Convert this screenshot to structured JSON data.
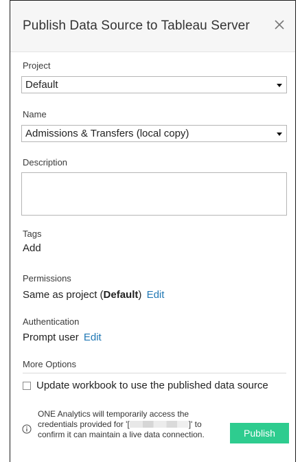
{
  "dialog": {
    "title": "Publish Data Source to Tableau Server",
    "close_icon": "close-icon"
  },
  "project": {
    "label": "Project",
    "value": "Default"
  },
  "name": {
    "label": "Name",
    "value": "Admissions & Transfers (local copy)"
  },
  "description": {
    "label": "Description",
    "value": ""
  },
  "tags": {
    "label": "Tags",
    "add_link": "Add"
  },
  "permissions": {
    "label": "Permissions",
    "value_prefix": "Same as project (",
    "value_bold": "Default",
    "value_suffix": ")",
    "edit_link": "Edit"
  },
  "authentication": {
    "label": "Authentication",
    "value": "Prompt user",
    "edit_link": "Edit"
  },
  "more_options": {
    "label": "More Options",
    "checkbox_label": "Update workbook to use the published data source",
    "checked": false
  },
  "notice": {
    "icon": "info-icon",
    "text_before": "ONE Analytics will temporarily access the credentials provided for '[",
    "text_after": "]' to confirm it can maintain a live data connection."
  },
  "publish_button": "Publish",
  "colors": {
    "accent": "#2ecc8f",
    "link": "#1f77b4",
    "header_bg": "#f6f6f6"
  }
}
